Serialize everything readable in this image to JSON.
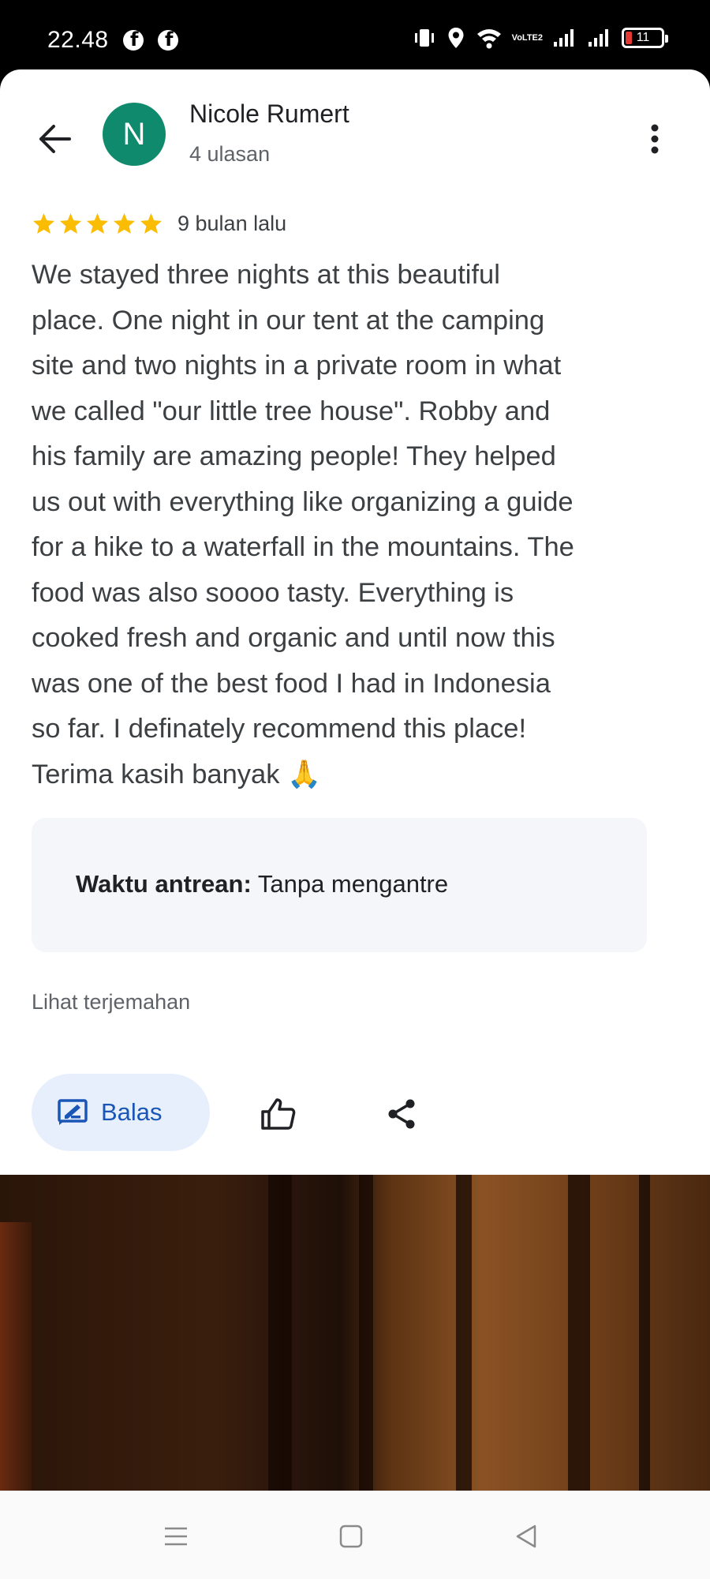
{
  "status_bar": {
    "time": "22.48",
    "icons": [
      "facebook-icon",
      "facebook-icon",
      "vibrate-icon",
      "location-icon",
      "wifi-icon",
      "volte-icon",
      "signal-icon",
      "signal-icon",
      "battery-icon"
    ],
    "volte_top": "Vo",
    "volte_bottom": "LTE2",
    "battery_level": "11"
  },
  "header": {
    "avatar_letter": "N",
    "avatar_color": "#0f8a6c",
    "author_name": "Nicole Rumert",
    "author_subtitle": "4 ulasan"
  },
  "review": {
    "rating": 5,
    "max_rating": 5,
    "star_color": "#fbbc04",
    "date": "9 bulan lalu",
    "lines": [
      "We stayed three nights at this beautiful",
      "place. One night in our tent at the camping",
      "site and two nights in a private room in what",
      "we called \"our little tree house\". Robby and",
      "his family are amazing people! They helped",
      "us out with everything like organizing a guide",
      "for a hike to a waterfall in the mountains. The",
      "food was also soooo tasty. Everything is",
      "cooked fresh and organic and until now this",
      "was one of the best food I had in Indonesia",
      "so far. I definately recommend this place!",
      "Terima kasih banyak 🙏"
    ]
  },
  "info": {
    "label": "Waktu antrean:",
    "value": "Tanpa mengantre"
  },
  "translate_link": "Lihat terjemahan",
  "actions": {
    "reply_label": "Balas",
    "accent_color": "#1a56b6"
  }
}
